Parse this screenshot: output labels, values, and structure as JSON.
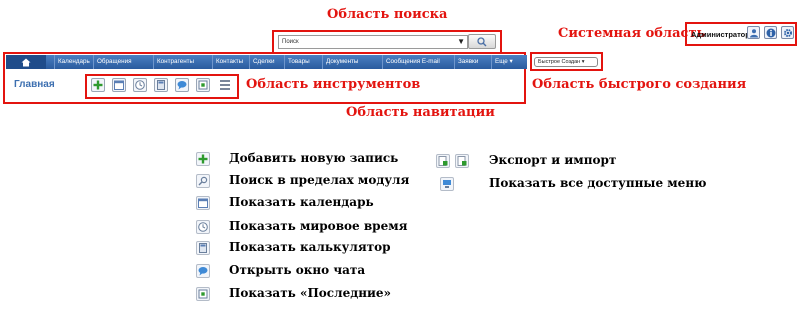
{
  "callouts": {
    "search_area": "Область поиска",
    "system_area": "Системная область",
    "tools_area": "Область инструментов",
    "quick_create_area": "Область быстрого создания",
    "navigation_area": "Область навитации"
  },
  "search": {
    "placeholder": "Поиск"
  },
  "system": {
    "user": "Администратор",
    "icons": [
      "user-icon",
      "info-icon",
      "gear-icon"
    ]
  },
  "nav": {
    "home_icon": "home-icon",
    "items": [
      "Календарь",
      "Обращения",
      "Контрагенты",
      "Контакты",
      "Сделки",
      "Товары",
      "Документы",
      "Сообщения E-mail",
      "Заявки",
      "Еще ▾"
    ]
  },
  "quick_create": {
    "label": "Быстрое Создан ▾"
  },
  "breadcrumb": {
    "home": "Главная"
  },
  "tools": [
    "add-icon",
    "calendar-icon",
    "clock-icon",
    "calculator-icon",
    "chat-icon",
    "recent-icon",
    "menu-icon"
  ],
  "legend": {
    "left": [
      {
        "icon": "add-icon",
        "text": "Добавить новую запись"
      },
      {
        "icon": "search-icon",
        "text": "Поиск в пределах модуля"
      },
      {
        "icon": "calendar-icon",
        "text": "Показать календарь"
      },
      {
        "icon": "clock-icon",
        "text": "Показать мировое время"
      },
      {
        "icon": "calculator-icon",
        "text": "Показать калькулятор"
      },
      {
        "icon": "chat-icon",
        "text": "Открыть окно чата"
      },
      {
        "icon": "recent-icon",
        "text": "Показать «Последние»"
      }
    ],
    "right": [
      {
        "icons": [
          "import-icon",
          "export-icon"
        ],
        "text": "Экспорт и импорт"
      },
      {
        "icons": [
          "menu-icon"
        ],
        "text": "Показать все доступные меню"
      }
    ]
  },
  "colors": {
    "accent_red": "#e3140f",
    "nav_blue": "#2f62a8",
    "link_blue": "#3c6fb0"
  }
}
